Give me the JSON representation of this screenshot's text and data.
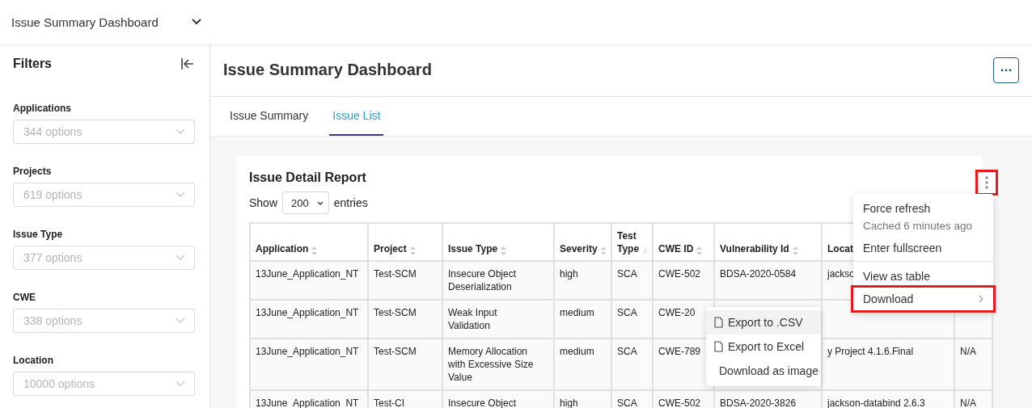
{
  "dashboard_selector": {
    "label": "Issue Summary Dashboard"
  },
  "filters": {
    "title": "Filters",
    "fields": [
      {
        "label": "Applications",
        "placeholder": "344 options"
      },
      {
        "label": "Projects",
        "placeholder": "619 options"
      },
      {
        "label": "Issue Type",
        "placeholder": "377 options"
      },
      {
        "label": "CWE",
        "placeholder": "338 options"
      },
      {
        "label": "Location",
        "placeholder": "10000 options"
      }
    ]
  },
  "page": {
    "title": "Issue Summary Dashboard"
  },
  "tabs": [
    {
      "label": "Issue Summary",
      "selected": false
    },
    {
      "label": "Issue List",
      "selected": true
    }
  ],
  "report": {
    "title": "Issue Detail Report",
    "show_label": "Show",
    "page_size": "200",
    "entries_label": "entries",
    "menu_button": {
      "highlighted": true
    },
    "table": {
      "columns": [
        {
          "label": "Application",
          "sortable": true
        },
        {
          "label": "Project",
          "sortable": true
        },
        {
          "label": "Issue Type",
          "sortable": true
        },
        {
          "label": "Severity",
          "sortable": true
        },
        {
          "label": "Test Type",
          "sortable": true
        },
        {
          "label": "CWE ID",
          "sortable": true
        },
        {
          "label": "Vulnerability Id",
          "sortable": true
        },
        {
          "label": "Locat"
        }
      ],
      "rows": [
        [
          "13June_Application_NT",
          "Test-SCM",
          "Insecure Object Deserialization",
          "high",
          "SCA",
          "CWE-502",
          "BDSA-2020-0584",
          "jackso",
          null
        ],
        [
          "13June_Application_NT",
          "Test-SCM",
          "Weak Input Validation",
          "medium",
          "SCA",
          "CWE-20",
          null,
          null,
          null
        ],
        [
          "13June_Application_NT",
          "Test-SCM",
          "Memory Allocation with Excessive Size Value",
          "medium",
          "SCA",
          "CWE-789",
          null,
          "y Project 4.1.6.Final",
          "N/A"
        ],
        [
          "13June_Application_NT",
          "Test-CI",
          "Insecure Object",
          "high",
          "SCA",
          "CWE-502",
          "BDSA-2020-3826",
          "jackson-databind 2.6.3",
          "N/A"
        ]
      ]
    },
    "menu": {
      "groups": [
        [
          {
            "kind": "action",
            "label": "Force refresh",
            "note": "Cached 6 minutes ago",
            "highlighted": false
          },
          {
            "kind": "action",
            "label": "Enter fullscreen",
            "highlighted": false
          }
        ],
        [
          {
            "kind": "action",
            "label": "View as table",
            "highlighted": false
          },
          {
            "kind": "submenu",
            "label": "Download",
            "highlighted": true
          }
        ]
      ]
    },
    "submenu": [
      {
        "label": "Export to .CSV",
        "kind": "file",
        "hovered": true
      },
      {
        "label": "Export to Excel",
        "kind": "file",
        "hovered": false
      },
      {
        "label": "Download as image",
        "kind": "image",
        "hovered": false
      }
    ]
  }
}
